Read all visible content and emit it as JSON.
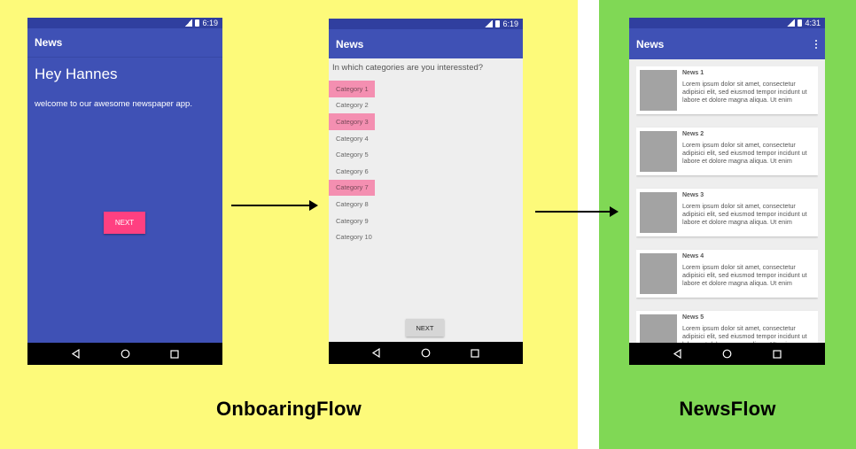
{
  "colors": {
    "onboarding_bg": "#fdfa7a",
    "news_bg": "#80d855",
    "primary": "#3f51b5",
    "primary_dark": "#303f9f",
    "accent": "#ff4081",
    "selected_category": "#f48fb1"
  },
  "labels": {
    "onboarding": "OnboaringFlow",
    "news": "NewsFlow"
  },
  "phone1": {
    "time": "6:19",
    "title": "News",
    "greeting": "Hey Hannes",
    "welcome": "welcome to our awesome newspaper app.",
    "next": "NEXT"
  },
  "phone2": {
    "time": "6:19",
    "title": "News",
    "question": "In which categories are you interessted?",
    "categories": [
      {
        "label": "Category 1",
        "selected": true
      },
      {
        "label": "Category 2",
        "selected": false
      },
      {
        "label": "Category 3",
        "selected": true
      },
      {
        "label": "Category 4",
        "selected": false
      },
      {
        "label": "Category 5",
        "selected": false
      },
      {
        "label": "Category 6",
        "selected": false
      },
      {
        "label": "Category 7",
        "selected": true
      },
      {
        "label": "Category 8",
        "selected": false
      },
      {
        "label": "Category 9",
        "selected": false
      },
      {
        "label": "Category 10",
        "selected": false
      }
    ],
    "next": "NEXT"
  },
  "phone3": {
    "time": "4:31",
    "title": "News",
    "news": [
      {
        "title": "News 1",
        "body": "Lorem ipsum dolor sit amet, consectetur adipisici elit, sed eiusmod tempor incidunt ut labore et dolore magna aliqua. Ut enim"
      },
      {
        "title": "News 2",
        "body": "Lorem ipsum dolor sit amet, consectetur adipisici elit, sed eiusmod tempor incidunt ut labore et dolore magna aliqua. Ut enim"
      },
      {
        "title": "News 3",
        "body": "Lorem ipsum dolor sit amet, consectetur adipisici elit, sed eiusmod tempor incidunt ut labore et dolore magna aliqua. Ut enim"
      },
      {
        "title": "News 4",
        "body": "Lorem ipsum dolor sit amet, consectetur adipisici elit, sed eiusmod tempor incidunt ut labore et dolore magna aliqua. Ut enim"
      },
      {
        "title": "News 5",
        "body": "Lorem ipsum dolor sit amet, consectetur adipisici elit, sed eiusmod tempor incidunt ut labore et dolore magna aliqua. Ut enim"
      }
    ]
  },
  "icons": {
    "signal": "signal-icon",
    "battery": "battery-icon",
    "back": "back-icon",
    "home": "home-icon",
    "recents": "recents-icon",
    "overflow": "more-vert-icon"
  }
}
